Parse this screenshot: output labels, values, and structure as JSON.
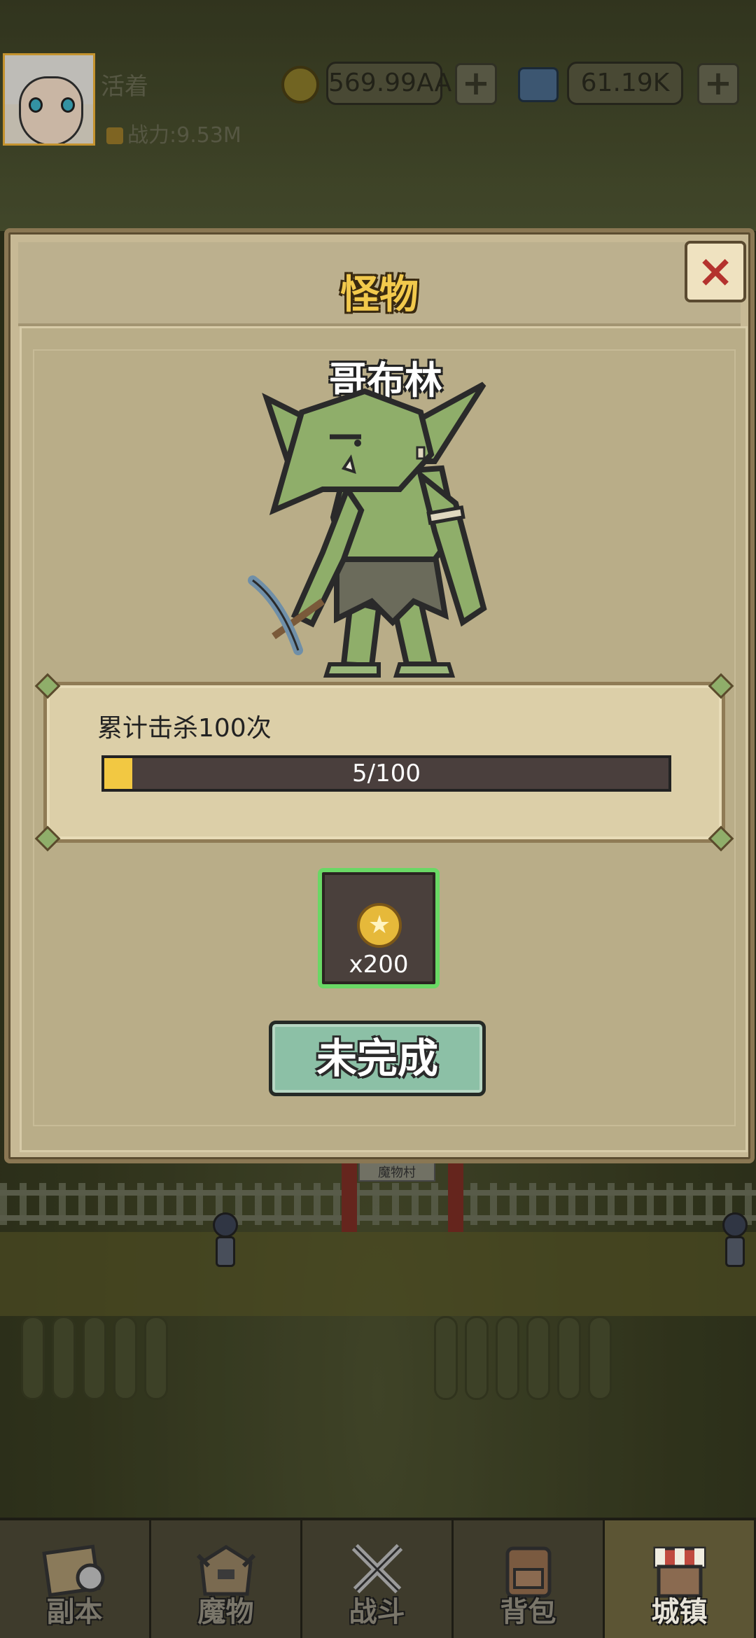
{
  "header": {
    "player_name": "活着",
    "power_label": "战力:9.53M",
    "gold": "569.99AA",
    "gems": "61.19K",
    "plus_label": "+"
  },
  "modal": {
    "title": "怪物",
    "close_label": "×",
    "monster_name": "哥布林",
    "quest": {
      "description": "累计击杀100次",
      "progress_text": "5/100",
      "progress_value": 5,
      "progress_max": 100
    },
    "reward": {
      "icon": "gold-coin-icon",
      "quantity": "x200"
    },
    "status_button": "未完成"
  },
  "background": {
    "sign_text": "魔物村"
  },
  "nav": {
    "items": [
      {
        "label": "副本",
        "icon": "map-icon",
        "active": false
      },
      {
        "label": "魔物",
        "icon": "monster-icon",
        "active": false
      },
      {
        "label": "战斗",
        "icon": "crossed-swords-icon",
        "active": false
      },
      {
        "label": "背包",
        "icon": "backpack-icon",
        "active": false
      },
      {
        "label": "城镇",
        "icon": "shop-icon",
        "active": true
      }
    ]
  },
  "colors": {
    "accent_gold": "#f2c94c",
    "progress_fill": "#f2c842",
    "reward_border": "#6ad865",
    "close_x": "#b4322e",
    "status_button": "#8cc0a6"
  }
}
